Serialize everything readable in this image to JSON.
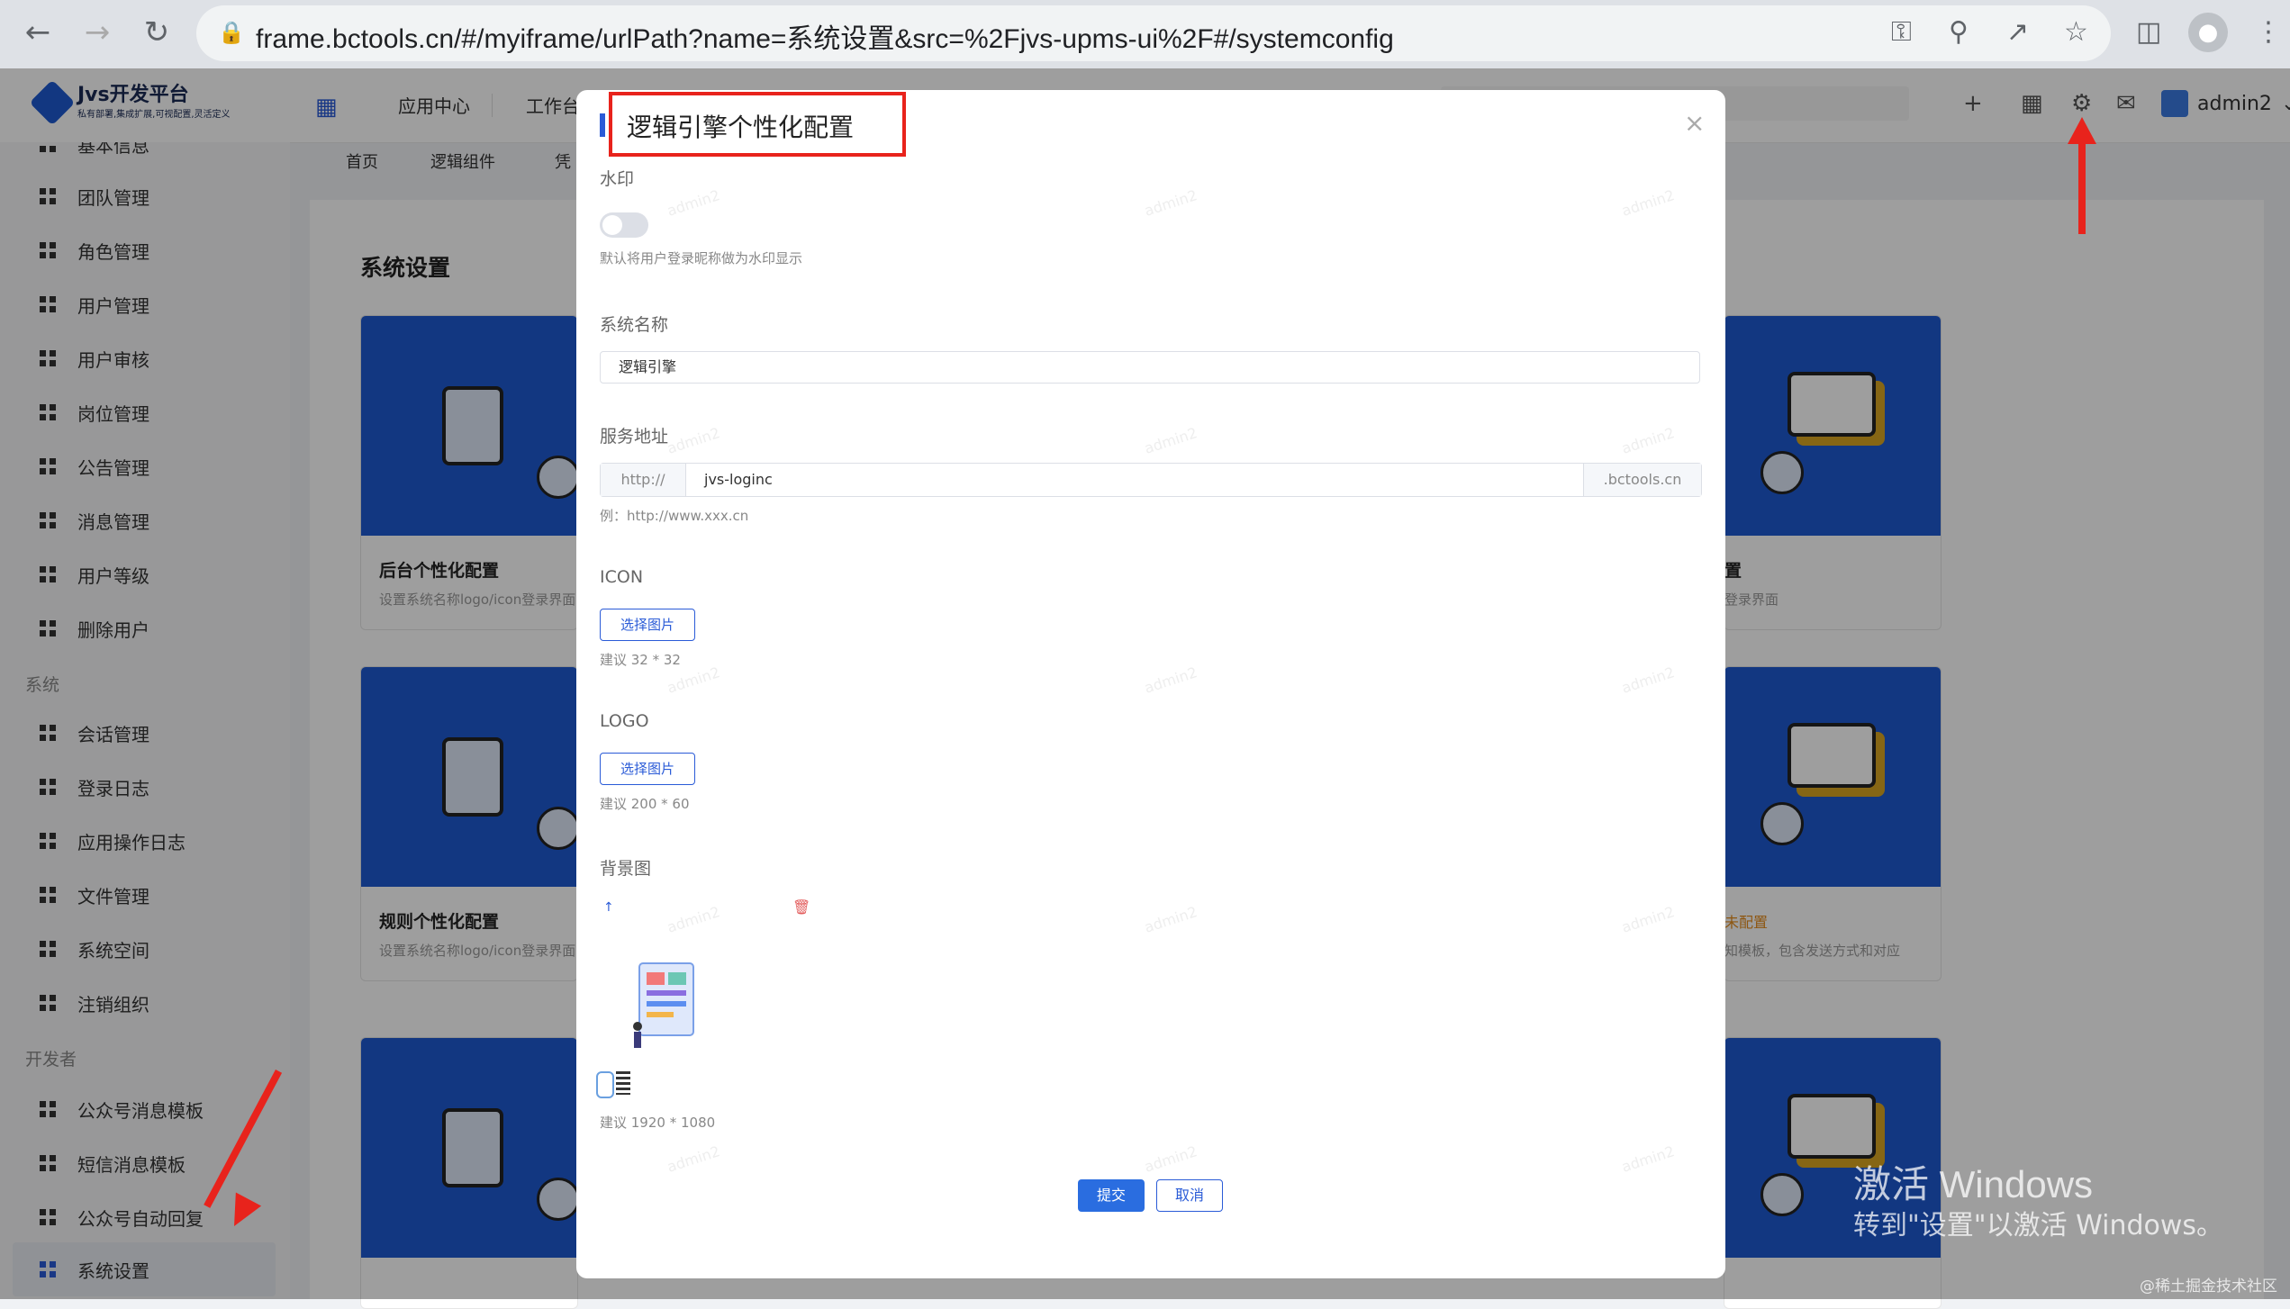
{
  "browser": {
    "url": "frame.bctools.cn/#/myiframe/urlPath?name=系统设置&src=%2Fjvs-upms-ui%2F#/systemconfig"
  },
  "app": {
    "logo_title": "Jvs开发平台",
    "logo_subtitle": "私有部署,集成扩展,可视配置,灵活定义",
    "nav": [
      "应用中心",
      "工作台"
    ],
    "user": "admin2"
  },
  "tabs": [
    "首页",
    "逻辑组件",
    "凭"
  ],
  "sidebar": {
    "top_partial": "基本信息",
    "items_a": [
      "团队管理",
      "角色管理",
      "用户管理",
      "用户审核",
      "岗位管理",
      "公告管理",
      "消息管理",
      "用户等级",
      "删除用户"
    ],
    "group_system": "系统",
    "items_b": [
      "会话管理",
      "登录日志",
      "应用操作日志",
      "文件管理",
      "系统空间",
      "注销组织"
    ],
    "group_dev": "开发者",
    "items_c": [
      "公众号消息模板",
      "短信消息模板",
      "公众号自动回复",
      "系统设置"
    ]
  },
  "main": {
    "page_title": "系统设置",
    "cards_left": [
      {
        "title": "后台个性化配置",
        "desc": "设置系统名称logo/icon登录界面"
      },
      {
        "title": "规则个性化配置",
        "desc": "设置系统名称logo/icon登录界面"
      }
    ],
    "cards_right": [
      {
        "title": "置",
        "desc": "登录界面"
      },
      {
        "badge": "未配置",
        "desc": "知模板，包含发送方式和对应"
      }
    ]
  },
  "modal": {
    "title": "逻辑引擎个性化配置",
    "close": "×",
    "watermark_label": "水印",
    "watermark_hint": "默认将用户登录昵称做为水印显示",
    "watermark_text": "admin2",
    "sysname_label": "系统名称",
    "sysname_value": "逻辑引擎",
    "service_label": "服务地址",
    "service_prefix": "http://",
    "service_value": "jvs-loginc",
    "service_suffix": ".bctools.cn",
    "service_example": "例：http://www.xxx.cn",
    "icon_label": "ICON",
    "icon_button": "选择图片",
    "icon_hint": "建议 32 * 32",
    "logo_label": "LOGO",
    "logo_button": "选择图片",
    "logo_hint": "建议 200 * 60",
    "bg_label": "背景图",
    "bg_hint": "建议 1920 * 1080",
    "submit": "提交",
    "cancel": "取消"
  },
  "os_watermark": {
    "line1": "激活 Windows",
    "line2": "转到\"设置\"以激活 Windows。",
    "credit": "@稀土掘金技术社区"
  },
  "colors": {
    "accent": "#2a5bd7",
    "highlight": "#e8231c",
    "card_blue": "#1e5ad0"
  }
}
